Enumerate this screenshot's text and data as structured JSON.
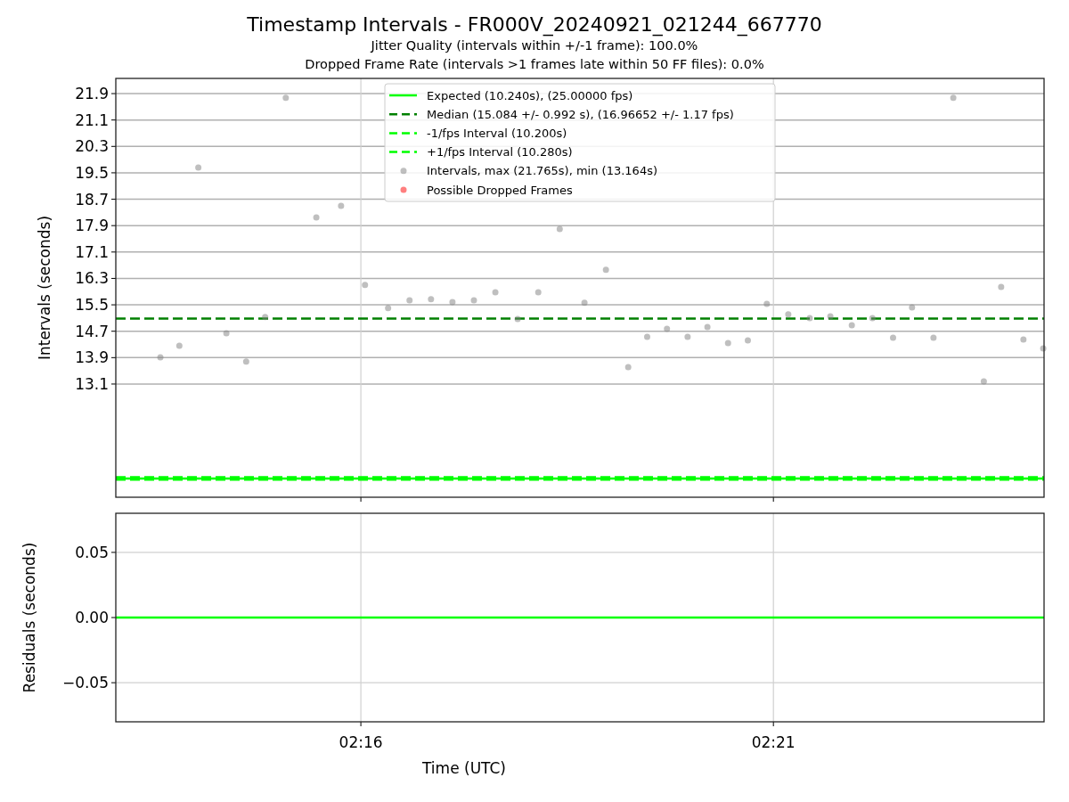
{
  "figure": {
    "title": "Timestamp Intervals - FR000V_20240921_021244_667770",
    "subtitles": [
      "Jitter Quality (intervals within +/-1 frame): 100.0%",
      "Dropped Frame Rate (intervals >1 frames late within 50 FF files): 0.0%"
    ]
  },
  "intervals_chart": {
    "chart_data": {
      "type": "scatter",
      "ylabel": "Intervals (seconds)",
      "grid": true,
      "legend": "upper center",
      "x": [
        133.57,
        133.8,
        134.03,
        134.37,
        134.61,
        134.84,
        135.09,
        135.46,
        135.76,
        136.05,
        136.33,
        136.59,
        136.85,
        137.11,
        137.37,
        137.63,
        137.9,
        138.15,
        138.41,
        138.71,
        138.97,
        139.24,
        139.47,
        139.71,
        139.96,
        140.2,
        140.45,
        140.69,
        140.92,
        141.18,
        141.44,
        141.69,
        141.95,
        142.2,
        142.45,
        142.68,
        142.94,
        143.18,
        143.55,
        143.76,
        144.03,
        144.27
      ],
      "xlim": [
        133.03,
        144.28
      ],
      "ylim": [
        9.67,
        22.36
      ],
      "yticks": [
        {
          "value": 13.1,
          "label": "13.1"
        },
        {
          "value": 13.9,
          "label": "13.9"
        },
        {
          "value": 14.7,
          "label": "14.7"
        },
        {
          "value": 15.5,
          "label": "15.5"
        },
        {
          "value": 16.3,
          "label": "16.3"
        },
        {
          "value": 17.1,
          "label": "17.1"
        },
        {
          "value": 17.9,
          "label": "17.9"
        },
        {
          "value": 18.7,
          "label": "18.7"
        },
        {
          "value": 19.5,
          "label": "19.5"
        },
        {
          "value": 20.3,
          "label": "20.3"
        },
        {
          "value": 21.1,
          "label": "21.1"
        },
        {
          "value": 21.9,
          "label": "21.9"
        }
      ],
      "ref_lines": [
        {
          "axis": "y",
          "value": 10.24,
          "label": "Expected (10.240s), (25.00000 fps)",
          "color": "#00ff00"
        },
        {
          "axis": "y",
          "value": 15.084,
          "label": "Median (15.084 +/- 0.992 s), (16.96652 +/- 1.17 fps)",
          "color": "#008000"
        },
        {
          "axis": "y",
          "value": 10.2,
          "label": "-1/fps Interval (10.200s)",
          "color": "#00ff00"
        },
        {
          "axis": "y",
          "value": 10.28,
          "label": "+1/fps Interval (10.280s)",
          "color": "#00ff00"
        }
      ],
      "series": [
        {
          "name": "Intervals, max (21.765s), min (13.164s)",
          "color": "#808080",
          "values": [
            13.91,
            14.26,
            19.66,
            14.64,
            13.78,
            15.13,
            21.77,
            18.15,
            18.5,
            16.1,
            15.4,
            15.64,
            15.67,
            15.58,
            15.64,
            15.88,
            15.07,
            15.88,
            17.8,
            15.56,
            16.56,
            13.61,
            14.53,
            14.77,
            14.53,
            14.83,
            14.34,
            14.42,
            15.53,
            15.21,
            15.1,
            15.15,
            14.88,
            15.1,
            14.5,
            15.42,
            14.5,
            21.77,
            13.18,
            16.04,
            14.45,
            14.18
          ]
        },
        {
          "name": "Possible Dropped Frames",
          "color": "#ff0000",
          "values": [
            null,
            null,
            null,
            null,
            null,
            null,
            null,
            null,
            null,
            null,
            null,
            null,
            null,
            null,
            null,
            null,
            null,
            null,
            null,
            null,
            null,
            null,
            null,
            null,
            null,
            null,
            null,
            null,
            null,
            null,
            null,
            null,
            null,
            null,
            null,
            null,
            null,
            null,
            null,
            null,
            null,
            null
          ]
        }
      ]
    }
  },
  "residuals_chart": {
    "chart_data": {
      "type": "line",
      "xlabel": "Time (UTC)",
      "ylabel": "Residuals (seconds)",
      "grid": true,
      "x": [
        133.03,
        144.28
      ],
      "xlim": [
        133.03,
        144.28
      ],
      "ylim": [
        -0.08,
        0.08
      ],
      "xticks": [
        {
          "value": 136,
          "label": "02:16"
        },
        {
          "value": 141,
          "label": "02:21"
        }
      ],
      "yticks": [
        {
          "value": 0.05,
          "label": "0.05"
        },
        {
          "value": 0,
          "label": "0.00"
        },
        {
          "value": -0.05,
          "label": "−0.05"
        }
      ],
      "series": [
        {
          "color": "#00ff00",
          "values": [
            0,
            0
          ]
        }
      ]
    }
  }
}
